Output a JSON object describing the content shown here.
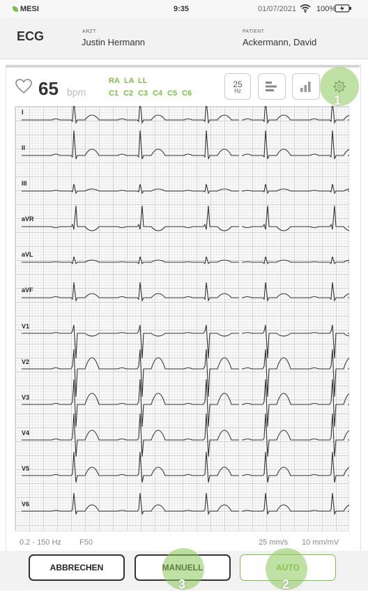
{
  "status_bar": {
    "brand": "MESI",
    "time": "9:35",
    "date": "01/07/2021",
    "battery": "100%"
  },
  "header": {
    "title": "ECG",
    "doctor_label": "ARZT",
    "doctor_name": "Justin Hermann",
    "patient_label": "PATIENT",
    "patient_name": "Ackermann, David"
  },
  "monitor": {
    "heart_rate": "65",
    "heart_rate_unit": "bpm",
    "electrodes_row1": [
      "RA",
      "LA",
      "LL"
    ],
    "electrodes_row2": [
      "C1",
      "C2",
      "C3",
      "C4",
      "C5",
      "C6"
    ],
    "filter_value": "25",
    "filter_unit": "Hz",
    "accent_color": "#7bc142"
  },
  "leads": [
    "I",
    "II",
    "III",
    "aVR",
    "aVL",
    "aVF",
    "V1",
    "V2",
    "V3",
    "V4",
    "V5",
    "V6"
  ],
  "footer": {
    "bandwidth": "0.2 - 150 Hz",
    "filter": "F50",
    "speed": "25 mm/s",
    "gain": "10 mm/mV"
  },
  "buttons": {
    "cancel": "ABBRECHEN",
    "manual": "MANUELL",
    "auto": "AUTO"
  },
  "callouts": [
    "1",
    "2",
    "3"
  ]
}
